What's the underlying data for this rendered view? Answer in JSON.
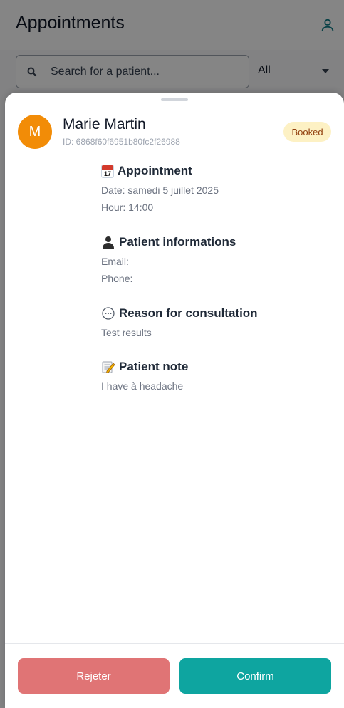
{
  "header": {
    "title": "Appointments",
    "user_icon": "user-icon"
  },
  "search": {
    "placeholder": "Search for a patient...",
    "value": ""
  },
  "filter": {
    "selected": "All"
  },
  "patient": {
    "initial": "M",
    "name": "Marie Martin",
    "id": "ID: 6868f60f6951b80fc2f26988",
    "status": "Booked",
    "avatar_color": "#f28c07"
  },
  "appointment": {
    "title": "Appointment",
    "icon_day": "17",
    "date": "Date: samedi 5 juillet 2025",
    "hour": "Hour: 14:00"
  },
  "patient_info": {
    "title": "Patient informations",
    "email": "Email:",
    "phone": "Phone:"
  },
  "reason": {
    "title": "Reason for consultation",
    "text": "Test results"
  },
  "note": {
    "title": "Patient note",
    "text": "I have à headache"
  },
  "actions": {
    "reject": "Rejeter",
    "confirm": "Confirm"
  },
  "colors": {
    "reject": "#e07475",
    "confirm": "#0ea5a0",
    "badge_bg": "#fdf1c4",
    "badge_text": "#92400e"
  }
}
